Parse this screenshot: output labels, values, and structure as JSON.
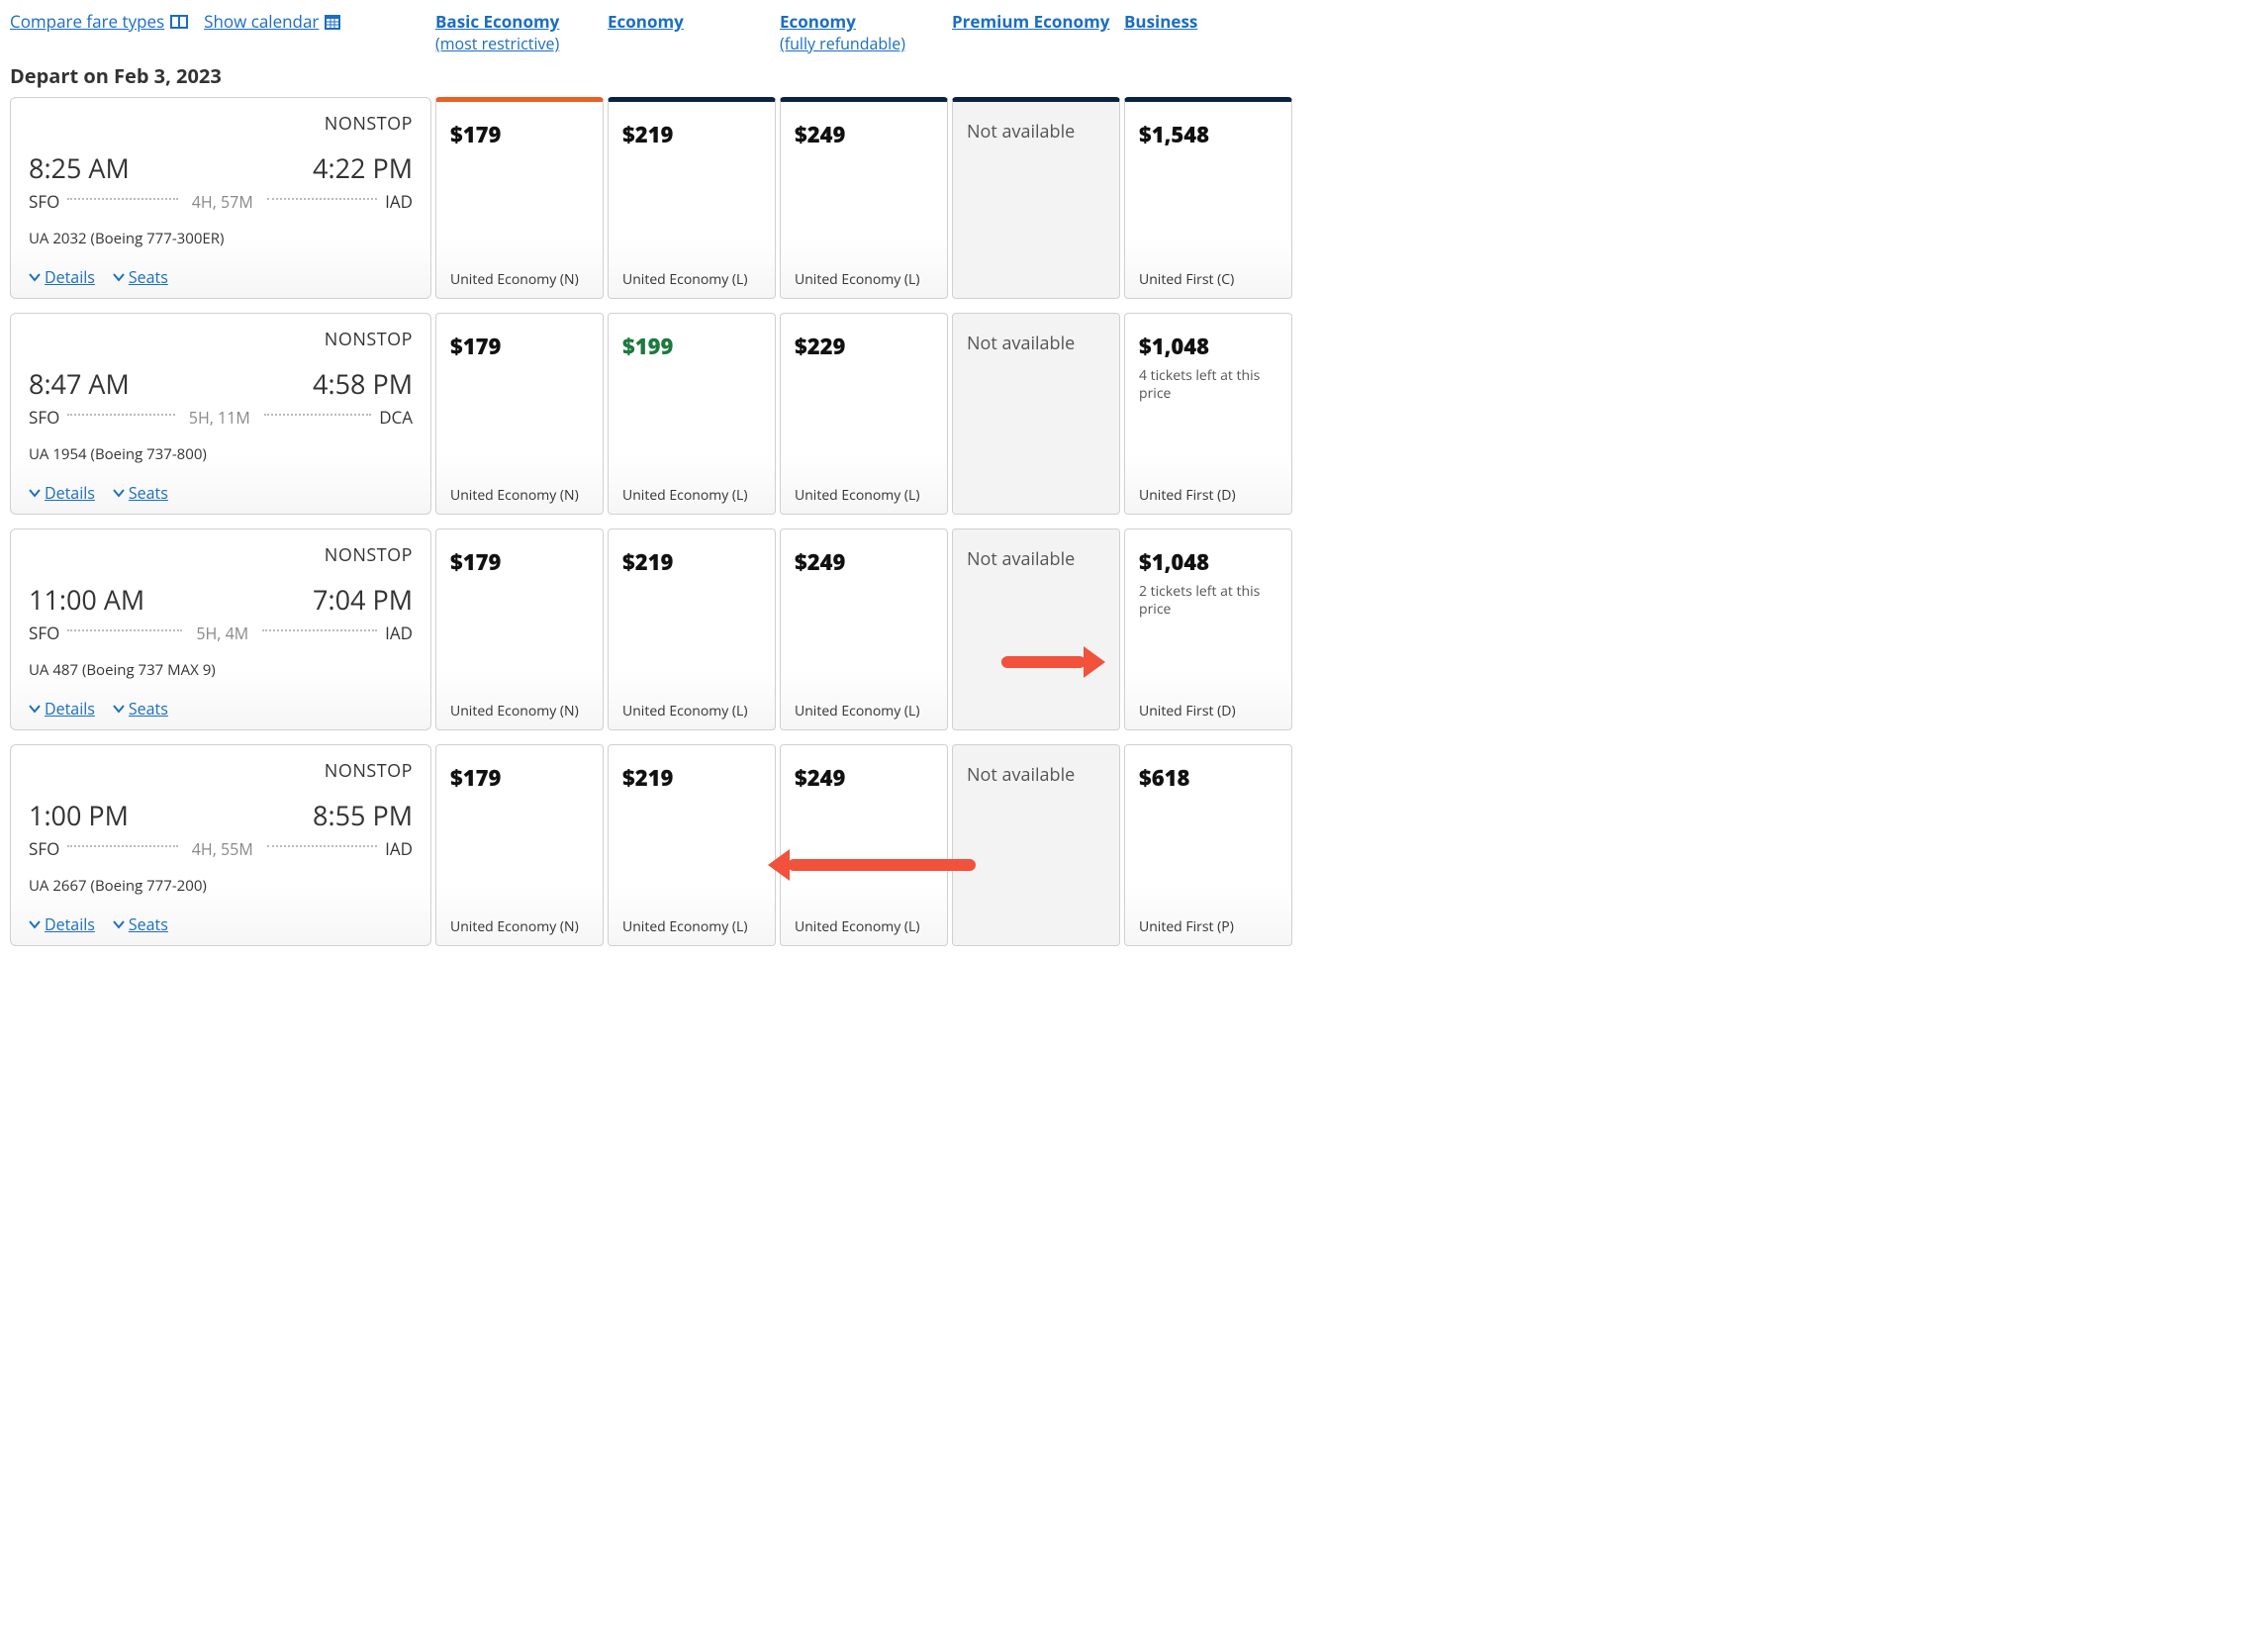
{
  "top_links": {
    "compare_label": "Compare fare types",
    "calendar_label": "Show calendar"
  },
  "fare_headers": [
    {
      "title": "Basic Economy",
      "sub": "(most restrictive)"
    },
    {
      "title": "Economy",
      "sub": ""
    },
    {
      "title": "Economy",
      "sub": "(fully refundable)"
    },
    {
      "title": "Premium Economy",
      "sub": ""
    },
    {
      "title": "Business",
      "sub": ""
    }
  ],
  "depart_label": "Depart on Feb 3, 2023",
  "details_label": "Details",
  "seats_label": "Seats",
  "na_text": "Not available",
  "flights": [
    {
      "stops": "NONSTOP",
      "dep_time": "8:25 AM",
      "arr_time": "4:22 PM",
      "dep_code": "SFO",
      "arr_code": "IAD",
      "duration": "4H, 57M",
      "airline": "UA 2032 (Boeing 777-300ER)",
      "fares": [
        {
          "price": "$179",
          "cabin": "United Economy (N)",
          "green": false,
          "na": false
        },
        {
          "price": "$219",
          "cabin": "United Economy (L)",
          "green": false,
          "na": false
        },
        {
          "price": "$249",
          "cabin": "United Economy (L)",
          "green": false,
          "na": false
        },
        {
          "na": true
        },
        {
          "price": "$1,548",
          "cabin": "United First (C)",
          "green": false,
          "na": false
        }
      ]
    },
    {
      "stops": "NONSTOP",
      "dep_time": "8:47 AM",
      "arr_time": "4:58 PM",
      "dep_code": "SFO",
      "arr_code": "DCA",
      "duration": "5H, 11M",
      "airline": "UA 1954 (Boeing 737-800)",
      "fares": [
        {
          "price": "$179",
          "cabin": "United Economy (N)",
          "green": false,
          "na": false
        },
        {
          "price": "$199",
          "cabin": "United Economy (L)",
          "green": true,
          "na": false
        },
        {
          "price": "$229",
          "cabin": "United Economy (L)",
          "green": false,
          "na": false
        },
        {
          "na": true
        },
        {
          "price": "$1,048",
          "cabin": "United First (D)",
          "green": false,
          "na": false,
          "note": "4 tickets left at this price"
        }
      ]
    },
    {
      "stops": "NONSTOP",
      "dep_time": "11:00 AM",
      "arr_time": "7:04 PM",
      "dep_code": "SFO",
      "arr_code": "IAD",
      "duration": "5H, 4M",
      "airline": "UA 487 (Boeing 737 MAX 9)",
      "fares": [
        {
          "price": "$179",
          "cabin": "United Economy (N)",
          "green": false,
          "na": false
        },
        {
          "price": "$219",
          "cabin": "United Economy (L)",
          "green": false,
          "na": false
        },
        {
          "price": "$249",
          "cabin": "United Economy (L)",
          "green": false,
          "na": false
        },
        {
          "na": true
        },
        {
          "price": "$1,048",
          "cabin": "United First (D)",
          "green": false,
          "na": false,
          "note": "2 tickets left at this price"
        }
      ]
    },
    {
      "stops": "NONSTOP",
      "dep_time": "1:00 PM",
      "arr_time": "8:55 PM",
      "dep_code": "SFO",
      "arr_code": "IAD",
      "duration": "4H, 55M",
      "airline": "UA 2667 (Boeing 777-200)",
      "fares": [
        {
          "price": "$179",
          "cabin": "United Economy (N)",
          "green": false,
          "na": false
        },
        {
          "price": "$219",
          "cabin": "United Economy (L)",
          "green": false,
          "na": false
        },
        {
          "price": "$249",
          "cabin": "United Economy (L)",
          "green": false,
          "na": false
        },
        {
          "na": true
        },
        {
          "price": "$618",
          "cabin": "United First (P)",
          "green": false,
          "na": false
        }
      ]
    }
  ],
  "chart_data": {
    "type": "table",
    "title": "Depart on Feb 3, 2023 — fare matrix",
    "columns": [
      "Flight",
      "Basic Economy",
      "Economy",
      "Economy (fully refundable)",
      "Premium Economy",
      "Business"
    ],
    "rows": [
      [
        "UA 2032 8:25 AM SFO→IAD",
        179,
        219,
        249,
        null,
        1548
      ],
      [
        "UA 1954 8:47 AM SFO→DCA",
        179,
        199,
        229,
        null,
        1048
      ],
      [
        "UA 487 11:00 AM SFO→IAD",
        179,
        219,
        249,
        null,
        1048
      ],
      [
        "UA 2667 1:00 PM SFO→IAD",
        179,
        219,
        249,
        null,
        618
      ]
    ],
    "unit": "USD"
  },
  "annotations": {
    "arrow1": {
      "points_to": "row 3 Business",
      "direction": "right"
    },
    "arrow2": {
      "points_to": "row 4 Economy",
      "direction": "left"
    }
  }
}
